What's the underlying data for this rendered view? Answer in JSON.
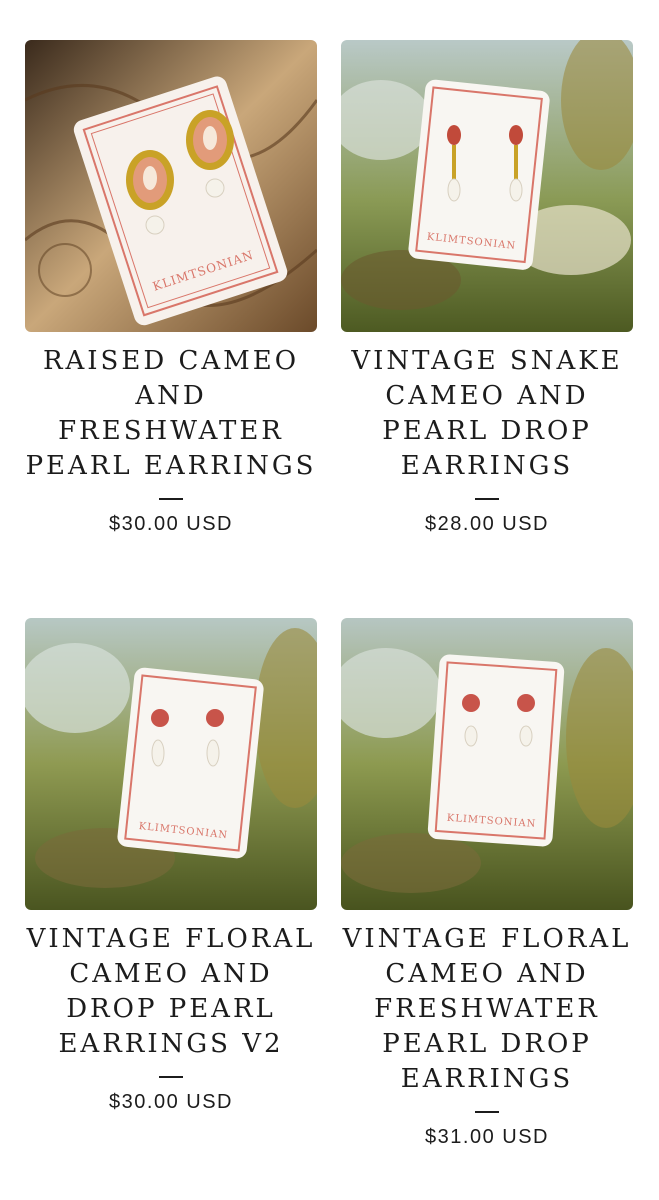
{
  "products": [
    {
      "title": "RAISED CAMEO AND FRESHWATER PEARL EARRINGS",
      "price": "$30.00 USD",
      "card_brand": "KLIMTSONIAN",
      "image_icon": "cameo-earrings-photo"
    },
    {
      "title": "VINTAGE SNAKE CAMEO AND PEARL DROP EARRINGS",
      "price": "$28.00 USD",
      "card_brand": "KLIMTSONIAN",
      "image_icon": "snake-cameo-earrings-photo"
    },
    {
      "title": "VINTAGE FLORAL CAMEO AND DROP PEARL EARRINGS V2",
      "price": "$30.00 USD",
      "card_brand": "KLIMTSONIAN",
      "image_icon": "floral-cameo-earrings-photo"
    },
    {
      "title": "VINTAGE FLORAL CAMEO AND FRESHWATER PEARL DROP EARRINGS",
      "price": "$31.00 USD",
      "card_brand": "KLIMTSONIAN",
      "image_icon": "floral-cameo-pearl-earrings-photo"
    }
  ],
  "colors": {
    "card_pink": "#d9766a",
    "gold": "#c9a227",
    "coral": "#d8694f",
    "text": "#1c1c1c"
  }
}
